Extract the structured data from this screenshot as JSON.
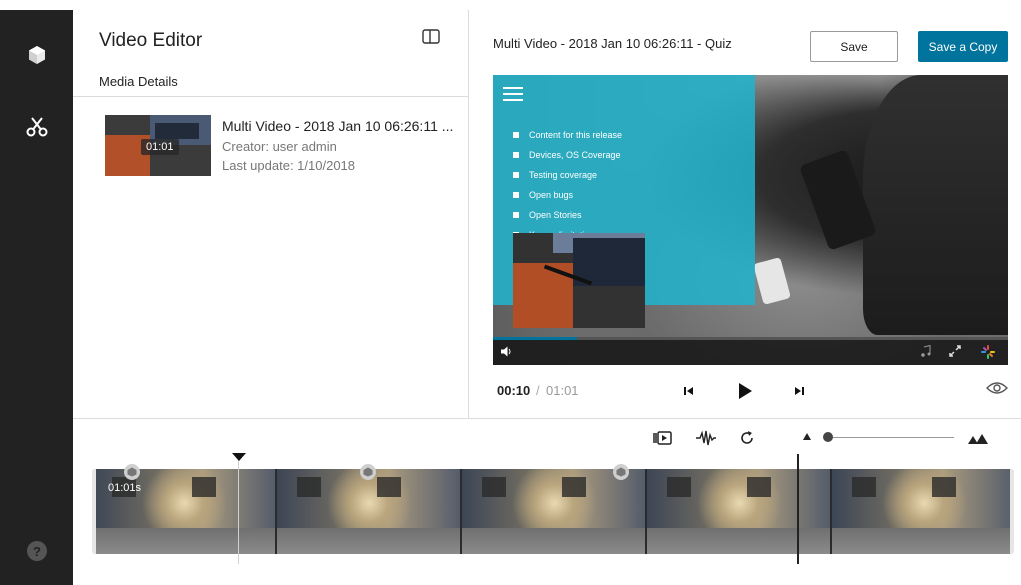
{
  "sidebar": {
    "icons": [
      "cube-icon",
      "scissors-icon",
      "help-icon"
    ],
    "help_label": "?"
  },
  "left_panel": {
    "title": "Video Editor",
    "section": "Media Details",
    "media": {
      "thumbnail_time": "01:01",
      "title": "Multi Video - 2018 Jan 10 06:26:11 ...",
      "creator": "Creator: user admin",
      "last_update": "Last update: 1/10/2018"
    }
  },
  "header": {
    "video_title": "Multi Video - 2018 Jan 10 06:26:11 - Quiz",
    "save_label": "Save",
    "save_copy_label": "Save a Copy",
    "accent": "#00749c"
  },
  "player": {
    "slide_bullets": [
      "Content for this release",
      "Devices, OS Coverage",
      "Testing coverage",
      "Open bugs",
      "Open Stories",
      "Known limitation"
    ],
    "slide_color": "#22b2ca",
    "progress": 0.164
  },
  "transport": {
    "current_time": "00:10",
    "separator": "/",
    "duration": "01:01"
  },
  "timeline": {
    "start_label": "01:01s",
    "zoom_level": 0.0
  }
}
